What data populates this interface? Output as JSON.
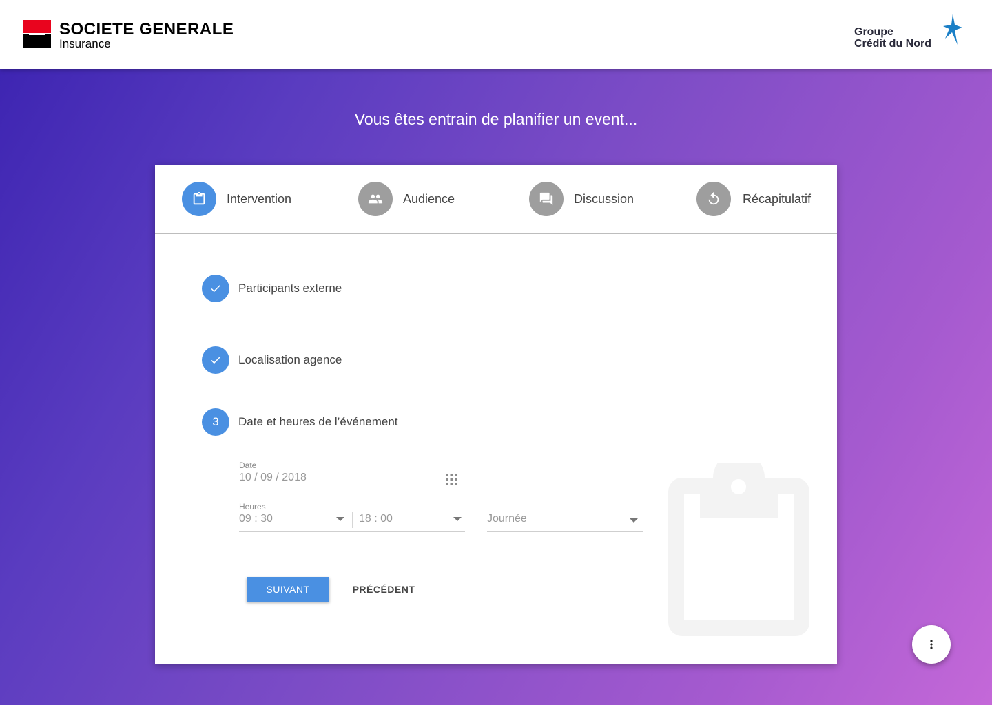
{
  "header": {
    "brand_name": "SOCIETE GENERALE",
    "brand_sub": "Insurance",
    "partner_line1": "Groupe",
    "partner_line2": "Crédit du Nord"
  },
  "page": {
    "title": "Vous êtes entrain de planifier un event..."
  },
  "stepper": {
    "steps": [
      {
        "label": "Intervention",
        "icon": "clipboard-icon",
        "state": "active"
      },
      {
        "label": "Audience",
        "icon": "people-icon",
        "state": "inactive"
      },
      {
        "label": "Discussion",
        "icon": "forum-icon",
        "state": "inactive"
      },
      {
        "label": "Récapitulatif",
        "icon": "restore-icon",
        "state": "inactive"
      }
    ]
  },
  "substeps": [
    {
      "label": "Participants externe",
      "state": "done",
      "icon": "check-icon"
    },
    {
      "label": "Localisation agence",
      "state": "done",
      "icon": "check-icon"
    },
    {
      "label": "Date et heures de l’événement",
      "state": "current",
      "number": "3"
    }
  ],
  "form": {
    "date_label": "Date",
    "date_value": "10 / 09 / 2018",
    "hours_label": "Heures",
    "start_time": "09 : 30",
    "end_time": "18 : 00",
    "period_placeholder": "Journée"
  },
  "actions": {
    "next_label": "SUIVANT",
    "prev_label": "PRÉCÉDENT"
  },
  "colors": {
    "accent": "#4a90e2",
    "inactive": "#9e9e9e",
    "brand_red": "#e9041e",
    "star_blue": "#1a7fc6"
  }
}
